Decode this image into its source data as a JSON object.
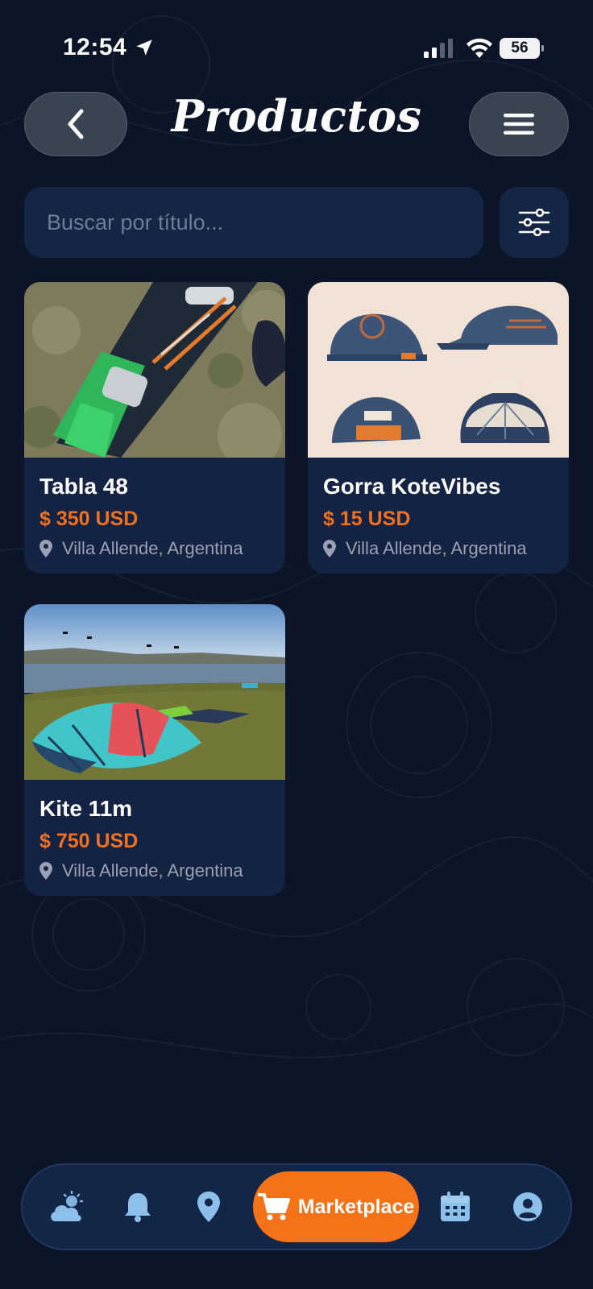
{
  "status_bar": {
    "time": "12:54",
    "battery": "56"
  },
  "header": {
    "title": "Productos",
    "back_icon": "chevron-left-icon",
    "menu_icon": "hamburger-menu-icon"
  },
  "search": {
    "placeholder": "Buscar por título...",
    "value": "",
    "filter_icon": "sliders-icon"
  },
  "products": [
    {
      "title": "Tabla 48",
      "price": "$ 350 USD",
      "location": "Villa Allende, Argentina"
    },
    {
      "title": "Gorra KoteVibes",
      "price": "$ 15 USD",
      "location": "Villa Allende, Argentina"
    },
    {
      "title": "Kite 11m",
      "price": "$ 750 USD",
      "location": "Villa Allende, Argentina"
    }
  ],
  "bottom_nav": {
    "items": [
      {
        "icon": "weather-icon"
      },
      {
        "icon": "bell-icon"
      },
      {
        "icon": "map-pin-icon"
      },
      {
        "icon": "cart-icon",
        "label": "Marketplace",
        "active": true
      },
      {
        "icon": "calendar-icon"
      },
      {
        "icon": "user-icon"
      }
    ]
  },
  "colors": {
    "background": "#0b1527",
    "card": "#142343",
    "accent": "#f47318",
    "price": "#f07020"
  }
}
